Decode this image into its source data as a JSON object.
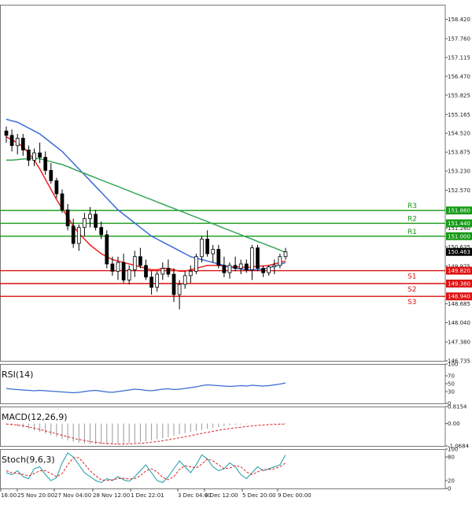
{
  "chart_data": {
    "type": "candlestick",
    "x_ticks": [
      "16:00",
      "25 Nov 20:00",
      "27 Nov 04:00",
      "28 Nov 12:00",
      "1 Dec 22:01",
      "3 Dec 04:00",
      "4 Dec 12:00",
      "5 Dec 20:00",
      "9 Dec 00:00"
    ],
    "y_ticks": [
      "158.420",
      "157.760",
      "157.115",
      "156.470",
      "155.825",
      "155.165",
      "154.520",
      "153.875",
      "153.230",
      "152.570",
      "151.280",
      "150.635",
      "149.975",
      "149.330",
      "148.685",
      "148.040",
      "147.380",
      "146.735"
    ],
    "ylim": [
      146.735,
      158.92
    ],
    "current_price": 150.463,
    "current_price_label": "150.463",
    "current_price_color": "#000000",
    "levels": [
      {
        "name": "R3",
        "value": 151.88,
        "label": "151.880",
        "color": "#159a15"
      },
      {
        "name": "R2",
        "value": 151.44,
        "label": "151.440",
        "color": "#159a15"
      },
      {
        "name": "R1",
        "value": 151.0,
        "label": "151.000",
        "color": "#159a15"
      },
      {
        "name": "S1",
        "value": 149.82,
        "label": "149.820",
        "color": "#dd1111"
      },
      {
        "name": "S2",
        "value": 149.38,
        "label": "149.380",
        "color": "#dd1111"
      },
      {
        "name": "S3",
        "value": 148.94,
        "label": "148.940",
        "color": "#dd1111"
      }
    ],
    "candles": [
      [
        154.6,
        154.75,
        154.2,
        154.45
      ],
      [
        154.45,
        154.65,
        153.9,
        154.1
      ],
      [
        154.1,
        154.5,
        153.8,
        154.35
      ],
      [
        154.35,
        154.5,
        153.75,
        153.95
      ],
      [
        153.95,
        154.1,
        153.4,
        153.6
      ],
      [
        153.6,
        154.0,
        153.4,
        153.85
      ],
      [
        153.85,
        154.2,
        153.5,
        153.7
      ],
      [
        153.7,
        153.9,
        153.1,
        153.25
      ],
      [
        153.25,
        153.5,
        152.8,
        152.9
      ],
      [
        152.9,
        153.0,
        152.3,
        152.45
      ],
      [
        152.45,
        152.6,
        151.8,
        151.9
      ],
      [
        151.9,
        152.1,
        151.2,
        151.35
      ],
      [
        151.35,
        151.6,
        150.6,
        150.75
      ],
      [
        150.75,
        151.4,
        150.5,
        151.3
      ],
      [
        151.3,
        151.8,
        151.0,
        151.6
      ],
      [
        151.6,
        152.0,
        151.3,
        151.75
      ],
      [
        151.75,
        151.9,
        151.2,
        151.3
      ],
      [
        151.3,
        151.5,
        150.9,
        151.05
      ],
      [
        151.05,
        151.2,
        149.9,
        150.05
      ],
      [
        150.05,
        150.3,
        149.65,
        149.8
      ],
      [
        149.8,
        150.3,
        149.5,
        150.1
      ],
      [
        150.1,
        150.4,
        149.4,
        149.5
      ],
      [
        149.5,
        150.0,
        149.35,
        149.85
      ],
      [
        149.85,
        150.5,
        149.6,
        150.3
      ],
      [
        150.3,
        150.6,
        149.9,
        150.0
      ],
      [
        150.0,
        150.2,
        149.5,
        149.6
      ],
      [
        149.6,
        149.8,
        149.0,
        149.25
      ],
      [
        149.25,
        149.8,
        149.1,
        149.7
      ],
      [
        149.7,
        150.1,
        149.5,
        149.9
      ],
      [
        149.9,
        150.2,
        149.6,
        149.7
      ],
      [
        149.7,
        149.9,
        148.75,
        149.0
      ],
      [
        149.0,
        149.5,
        148.5,
        149.35
      ],
      [
        149.35,
        149.8,
        149.2,
        149.65
      ],
      [
        149.65,
        150.0,
        149.4,
        149.8
      ],
      [
        149.8,
        150.4,
        149.7,
        150.3
      ],
      [
        150.3,
        151.0,
        150.1,
        150.9
      ],
      [
        150.9,
        151.2,
        150.3,
        150.4
      ],
      [
        150.4,
        150.7,
        150.1,
        150.55
      ],
      [
        150.55,
        150.7,
        149.9,
        150.0
      ],
      [
        150.0,
        150.3,
        149.6,
        149.75
      ],
      [
        149.75,
        150.1,
        149.55,
        150.0
      ],
      [
        150.0,
        150.3,
        149.8,
        149.9
      ],
      [
        149.9,
        150.2,
        149.7,
        150.05
      ],
      [
        150.05,
        150.2,
        149.75,
        149.85
      ],
      [
        149.85,
        150.7,
        149.5,
        150.6
      ],
      [
        150.6,
        150.7,
        149.8,
        149.9
      ],
      [
        149.9,
        150.0,
        149.6,
        149.75
      ],
      [
        149.75,
        150.0,
        149.65,
        149.95
      ],
      [
        149.95,
        150.2,
        149.7,
        150.0
      ],
      [
        150.0,
        150.4,
        149.9,
        150.3
      ],
      [
        150.3,
        150.6,
        150.2,
        150.463
      ]
    ],
    "series": [
      {
        "name": "MA fast",
        "color": "#ee2222",
        "values": [
          154.4,
          154.3,
          154.2,
          154.05,
          153.85,
          153.6,
          153.3,
          152.95,
          152.6,
          152.25,
          151.95,
          151.65,
          151.35,
          151.1,
          150.9,
          150.7,
          150.55,
          150.4,
          150.3,
          150.2,
          150.15,
          150.1,
          150.05,
          150.0,
          149.95,
          149.9,
          149.85,
          149.85,
          149.9,
          149.9,
          149.85,
          149.8,
          149.8,
          149.85,
          149.9,
          149.95,
          150.0,
          150.0,
          150.0,
          149.98,
          149.95,
          149.95,
          149.95,
          149.93,
          149.95,
          149.97,
          149.98,
          150.0,
          150.05,
          150.1,
          150.15
        ]
      },
      {
        "name": "MA medium",
        "color": "#3a6bd6",
        "values": [
          155.0,
          154.95,
          154.9,
          154.8,
          154.7,
          154.6,
          154.5,
          154.35,
          154.2,
          154.05,
          153.9,
          153.7,
          153.5,
          153.3,
          153.1,
          152.9,
          152.7,
          152.5,
          152.3,
          152.1,
          151.9,
          151.75,
          151.6,
          151.45,
          151.3,
          151.15,
          151.0,
          150.9,
          150.8,
          150.7,
          150.6,
          150.5,
          150.4,
          150.3,
          150.25,
          150.2,
          150.15,
          150.1,
          150.05,
          150.0,
          149.95,
          149.9,
          149.88,
          149.85,
          149.85,
          149.85,
          149.88,
          149.92,
          149.97,
          150.03,
          150.1
        ]
      },
      {
        "name": "MA slow",
        "color": "#3aa65a",
        "values": [
          153.6,
          153.6,
          153.62,
          153.64,
          153.65,
          153.66,
          153.65,
          153.6,
          153.55,
          153.5,
          153.45,
          153.38,
          153.3,
          153.22,
          153.15,
          153.07,
          153.0,
          152.92,
          152.85,
          152.77,
          152.7,
          152.62,
          152.55,
          152.47,
          152.4,
          152.32,
          152.25,
          152.17,
          152.1,
          152.02,
          151.95,
          151.87,
          151.8,
          151.72,
          151.65,
          151.57,
          151.5,
          151.42,
          151.35,
          151.27,
          151.2,
          151.12,
          151.05,
          150.97,
          150.9,
          150.82,
          150.75,
          150.67,
          150.6,
          150.52,
          150.45
        ]
      }
    ],
    "indicators": [
      {
        "name": "RSI(14)",
        "ticks": [
          "100",
          "70",
          "50",
          "30",
          "0"
        ],
        "ylim": [
          0,
          100
        ],
        "values": [
          38,
          36,
          35,
          34,
          33,
          32,
          33,
          32,
          31,
          30,
          29,
          28,
          27,
          28,
          30,
          32,
          33,
          31,
          29,
          28,
          30,
          32,
          34,
          36,
          35,
          33,
          32,
          34,
          36,
          37,
          35,
          36,
          38,
          40,
          42,
          45,
          47,
          46,
          45,
          44,
          43,
          44,
          45,
          44,
          46,
          45,
          44,
          45,
          47,
          49,
          52
        ]
      },
      {
        "name": "MACD(12,26,9)",
        "ticks": [
          "0.8154",
          "0.00",
          "-1.0684"
        ],
        "ylim": [
          -1.0684,
          0.8154
        ],
        "histogram": [
          -0.05,
          -0.08,
          -0.12,
          -0.18,
          -0.25,
          -0.32,
          -0.4,
          -0.48,
          -0.56,
          -0.64,
          -0.72,
          -0.8,
          -0.87,
          -0.92,
          -0.95,
          -0.97,
          -0.98,
          -0.99,
          -1.0,
          -1.0,
          -0.99,
          -0.97,
          -0.95,
          -0.92,
          -0.88,
          -0.84,
          -0.8,
          -0.75,
          -0.7,
          -0.64,
          -0.58,
          -0.52,
          -0.46,
          -0.4,
          -0.35,
          -0.3,
          -0.25,
          -0.2,
          -0.16,
          -0.12,
          -0.09,
          -0.06,
          -0.04,
          -0.02,
          -0.01,
          0.0,
          0.01,
          0.01,
          0.02,
          0.02,
          0.03
        ],
        "signal": [
          -0.02,
          -0.04,
          -0.07,
          -0.11,
          -0.16,
          -0.22,
          -0.28,
          -0.35,
          -0.42,
          -0.49,
          -0.56,
          -0.63,
          -0.7,
          -0.76,
          -0.81,
          -0.86,
          -0.9,
          -0.93,
          -0.95,
          -0.97,
          -0.98,
          -0.98,
          -0.97,
          -0.96,
          -0.94,
          -0.92,
          -0.89,
          -0.86,
          -0.82,
          -0.78,
          -0.73,
          -0.68,
          -0.63,
          -0.58,
          -0.52,
          -0.47,
          -0.42,
          -0.37,
          -0.32,
          -0.28,
          -0.24,
          -0.2,
          -0.17,
          -0.14,
          -0.11,
          -0.09,
          -0.07,
          -0.05,
          -0.04,
          -0.03,
          -0.02
        ]
      },
      {
        "name": "Stoch(9,6,3)",
        "ticks": [
          "100",
          "80",
          "20",
          "0"
        ],
        "ylim": [
          0,
          100
        ],
        "k": [
          40,
          35,
          45,
          30,
          25,
          50,
          55,
          35,
          20,
          28,
          65,
          90,
          80,
          60,
          40,
          30,
          20,
          15,
          25,
          20,
          30,
          22,
          18,
          30,
          45,
          60,
          40,
          20,
          15,
          30,
          50,
          70,
          55,
          40,
          60,
          85,
          75,
          55,
          45,
          50,
          65,
          55,
          35,
          25,
          40,
          55,
          45,
          50,
          55,
          60,
          85
        ],
        "d": [
          45,
          40,
          38,
          36,
          32,
          38,
          45,
          45,
          38,
          30,
          38,
          60,
          78,
          78,
          62,
          45,
          32,
          22,
          20,
          22,
          25,
          26,
          24,
          25,
          32,
          45,
          50,
          42,
          28,
          22,
          30,
          48,
          58,
          55,
          52,
          62,
          75,
          70,
          60,
          50,
          52,
          58,
          55,
          42,
          35,
          42,
          48,
          48,
          50,
          55,
          65
        ]
      }
    ]
  }
}
